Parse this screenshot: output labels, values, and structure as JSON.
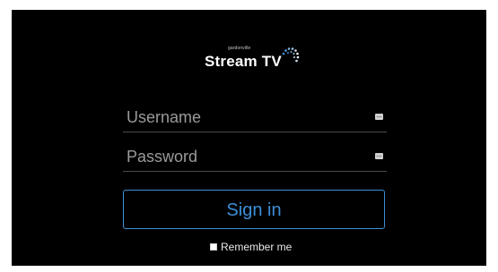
{
  "brand": {
    "small_text": "gardonville",
    "main_text": "Stream TV",
    "logo_dot_color": "#3d8fd6"
  },
  "form": {
    "username_placeholder": "Username",
    "password_placeholder": "Password",
    "signin_label": "Sign in",
    "remember_label": "Remember me",
    "remember_checked": false
  },
  "colors": {
    "accent": "#3d8fd6",
    "background": "#000000"
  }
}
